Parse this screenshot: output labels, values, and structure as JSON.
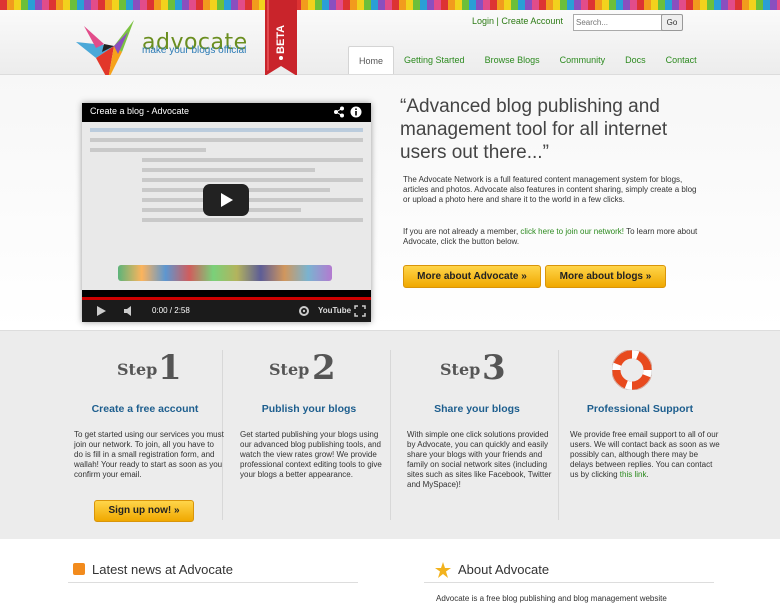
{
  "header": {
    "logo_text": "advocate",
    "tagline": "make your blogs official",
    "beta": "BETA",
    "login": "Login",
    "separator": "|",
    "create_account": "Create Account",
    "search_placeholder": "Search...",
    "go": "Go"
  },
  "nav": [
    "Home",
    "Getting Started",
    "Browse Blogs",
    "Community",
    "Docs",
    "Contact"
  ],
  "video": {
    "title": "Create a blog - Advocate",
    "time": "0:00 / 2:58",
    "brand": "YouTube"
  },
  "hero": {
    "quote": "“Advanced blog publishing and management tool for all internet users out there...”",
    "desc": "The Advocate Network is a full featured content management system for blogs, articles and photos. Advocate also features in content sharing, simply create a blog or upload a photo here and share it to the world in a few clicks.",
    "desc2_pre": "If you are not already a member, ",
    "desc2_link": "click here to join our network!",
    "desc2_post": " To learn more about Advocate, click the button below.",
    "btn_advocate": "More about Advocate »",
    "btn_blogs": "More about blogs »"
  },
  "steps": [
    {
      "word": "Step",
      "num": "1",
      "title": "Create a free account",
      "text": "To get started using our services you must join our network. To join, all you have to do is fill in a small registration form, and wallah! Your ready to start as soon as you confirm your email."
    },
    {
      "word": "Step",
      "num": "2",
      "title": "Publish your blogs",
      "text": "Get started publishing your blogs using our advanced blog publishing tools, and watch the view rates grow! We provide professional context editing tools to give your blogs a better appearance."
    },
    {
      "word": "Step",
      "num": "3",
      "title": "Share your blogs",
      "text": "With simple one click solutions provided by Advocate, you can quickly and easily share your blogs with your friends and family on social network sites (including sites such as sites like Facebook, Twitter and MySpace)!"
    },
    {
      "title": "Professional Support",
      "text_pre": "We provide free email support to all of our users. We will contact back as soon as we possibly can, although there may be delays between replies. You can contact us by clicking ",
      "text_link": "this link",
      "text_post": "."
    }
  ],
  "signup": "Sign up now! »",
  "bottom": {
    "news_title": "Latest news at Advocate",
    "about_title": "About Advocate",
    "about_text": "Advocate is a free blog publishing and blog management website"
  },
  "colors": {
    "accent_green": "#2c8a1f",
    "title_blue": "#1d5e8e",
    "button_orange": "#f0a800",
    "beta_red": "#c9242b"
  }
}
